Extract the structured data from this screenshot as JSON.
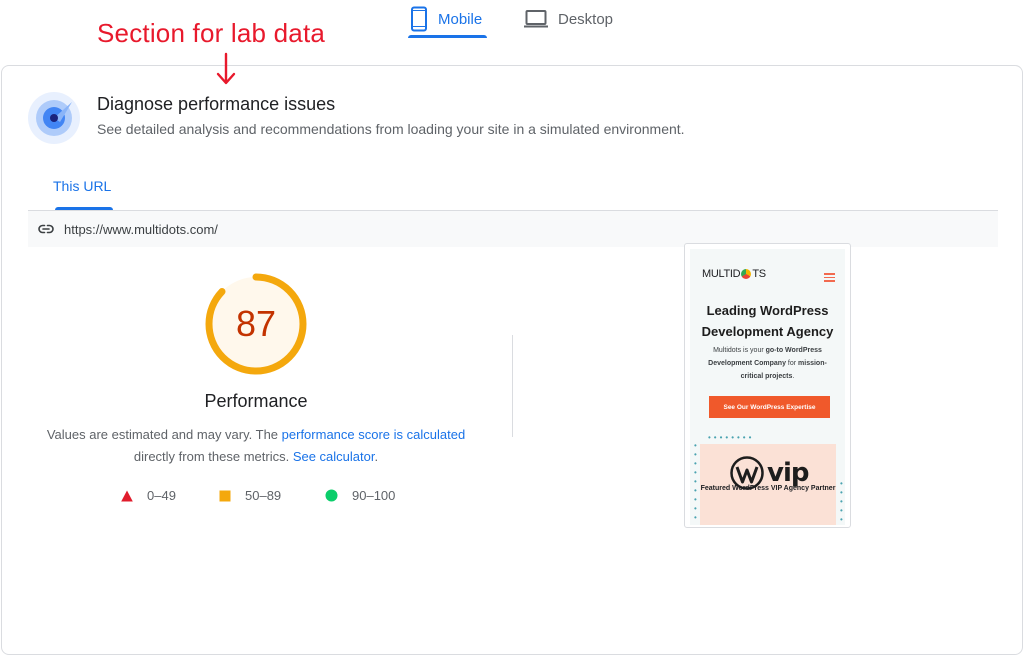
{
  "device_tabs": {
    "mobile": "Mobile",
    "desktop": "Desktop"
  },
  "annotation": {
    "text": "Section for lab data",
    "color": "#e8192c"
  },
  "lab": {
    "title": "Diagnose performance issues",
    "subtitle": "See detailed analysis and recommendations from loading your site in a simulated environment.",
    "tab_label": "This URL",
    "url": "https://www.multidots.com/"
  },
  "performance": {
    "score": "87",
    "score_fraction": 0.87,
    "label": "Performance",
    "desc_prefix": "Values are estimated and may vary. The ",
    "desc_link1": "performance score is calculated",
    "desc_middle": " directly from these metrics. ",
    "desc_link2": "See calculator",
    "desc_suffix": ".",
    "legend": [
      {
        "range": "0–49",
        "shape": "triangle",
        "color": "#e01c2c"
      },
      {
        "range": "50–89",
        "shape": "square",
        "color": "#f4a80d"
      },
      {
        "range": "90–100",
        "shape": "circle",
        "color": "#0cce6b"
      }
    ],
    "gauge_color": "#f4a80d",
    "gauge_fill": "#fff8ec"
  },
  "preview": {
    "logo_left": "MULTID",
    "logo_right": "TS",
    "headline": "Leading WordPress Development Agency",
    "text_1": "Multidots is your ",
    "text_bold_1": "go-to WordPress Development Company",
    "text_2": " for ",
    "text_bold_2": "mission-critical projects",
    "text_3": ".",
    "cta": "See Our WordPress Expertise",
    "vip_word": "vip",
    "vip_caption": "Featured WordPress VIP Agency Partner",
    "accent": "#f0592b"
  },
  "colors": {
    "primary_blue": "#1a73e8",
    "text": "#202124",
    "muted": "#5f6368"
  }
}
